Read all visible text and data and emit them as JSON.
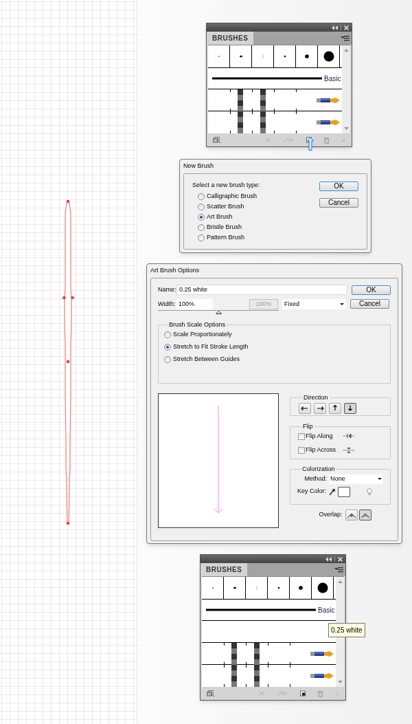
{
  "brushes_panels": [
    {
      "tab": "BRUSHES",
      "basic_label": "Basic",
      "empty_brush_row": false,
      "cursor_on_new_brush": true
    },
    {
      "tab": "BRUSHES",
      "basic_label": "Basic",
      "empty_brush_row": true,
      "cursor_on_new_brush": false,
      "tooltip": "0.25 white"
    }
  ],
  "new_brush": {
    "title": "New Brush",
    "prompt": "Select a new brush type:",
    "types": [
      {
        "label": "Calligraphic Brush",
        "selected": false
      },
      {
        "label": "Scatter Brush",
        "selected": false
      },
      {
        "label": "Art Brush",
        "selected": true
      },
      {
        "label": "Bristle Brush",
        "selected": false
      },
      {
        "label": "Pattern Brush",
        "selected": false
      }
    ],
    "buttons": [
      "OK",
      "Cancel"
    ]
  },
  "art_brush_options": {
    "title": "Art Brush Options",
    "name_label": "Name:",
    "name_value": "0.25 white",
    "width_label": "Width:",
    "width_value": "100%",
    "width_variation": "100%",
    "width_mode": "Fixed",
    "width_slider": {
      "level": 0.5
    },
    "buttons": [
      "OK",
      "Cancel"
    ],
    "scale_title": "Brush Scale Options",
    "scale_options": [
      {
        "label": "Scale Proportionately",
        "selected": false
      },
      {
        "label": "Stretch to Fit Stroke Length",
        "selected": true
      },
      {
        "label": "Stretch Between Guides",
        "selected": false
      }
    ],
    "direction_title": "Direction",
    "directions": [
      {
        "kind": "left",
        "selected": false
      },
      {
        "kind": "right",
        "selected": false
      },
      {
        "kind": "up",
        "selected": false
      },
      {
        "kind": "down",
        "selected": true
      }
    ],
    "flip_title": "Flip",
    "flips": [
      {
        "kind": "along",
        "label": "Flip Along",
        "checked": false
      },
      {
        "kind": "across",
        "label": "Flip Across",
        "checked": false
      }
    ],
    "colorization_title": "Colorization",
    "method_label": "Method:",
    "method_value": "None",
    "key_color_label": "Key Color:",
    "overlap_label": "Overlap:",
    "overlaps": [
      {
        "kind": "adjust",
        "selected": false
      },
      {
        "kind": "none",
        "selected": true
      }
    ]
  }
}
